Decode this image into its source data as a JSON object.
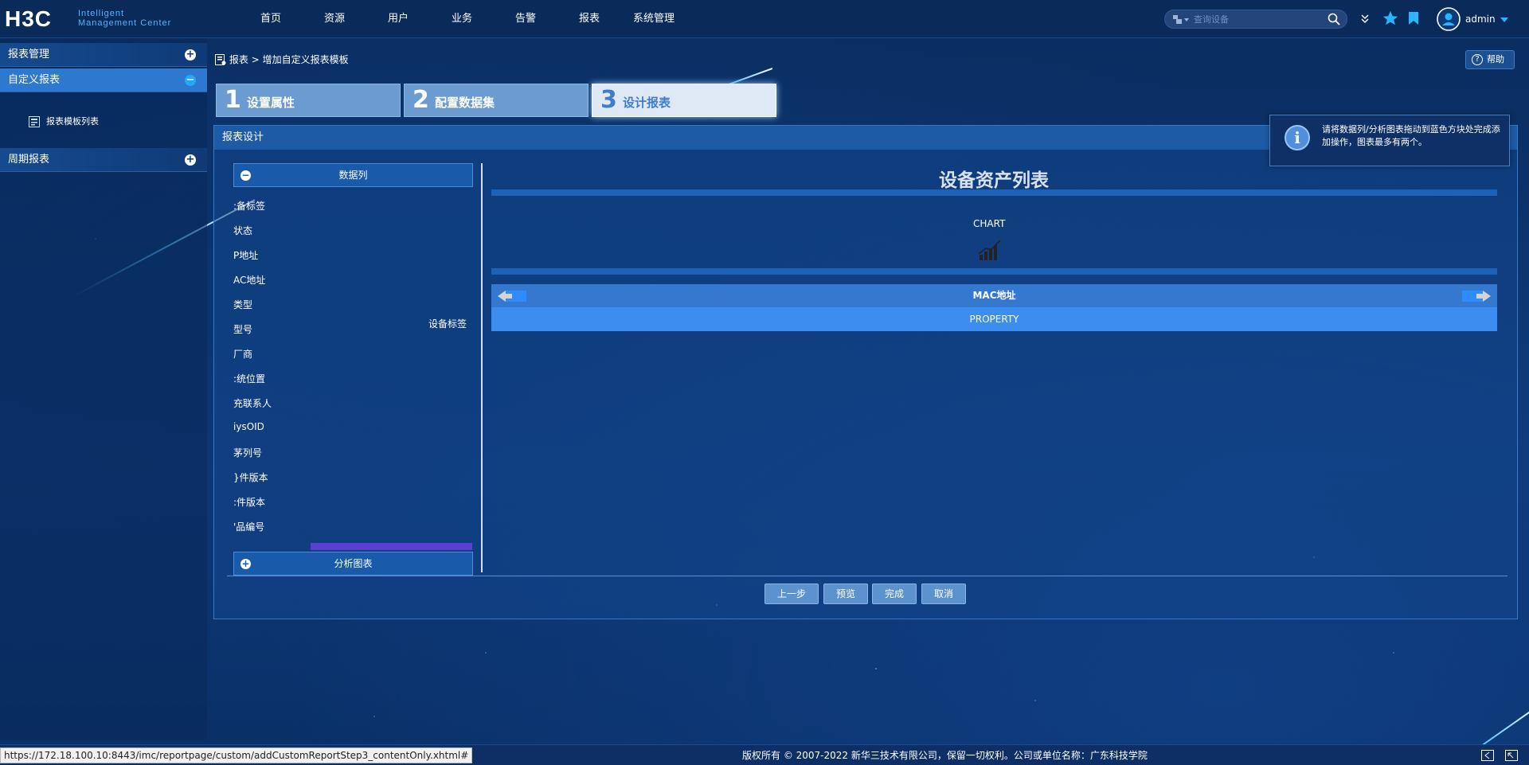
{
  "brand": {
    "logo": "H3C",
    "sub1": "Intelligent",
    "sub2": "Management Center"
  },
  "nav": [
    "首页",
    "资源",
    "用户",
    "业务",
    "告警",
    "报表",
    "系统管理"
  ],
  "search": {
    "placeholder": "查询设备"
  },
  "user": {
    "name": "admin"
  },
  "sidebar": {
    "group1": "报表管理",
    "active": "自定义报表",
    "sub_item": "报表模板列表",
    "group2": "周期报表"
  },
  "breadcrumb": {
    "root": "报表",
    "sep": ">",
    "current": "增加自定义报表模板"
  },
  "help": "帮助",
  "steps": [
    {
      "num": "1",
      "label": "设置属性"
    },
    {
      "num": "2",
      "label": "配置数据集"
    },
    {
      "num": "3",
      "label": "设计报表"
    }
  ],
  "panel": {
    "title": "报表设计"
  },
  "tooltip": "请将数据列/分析图表拖动到蓝色方块处完成添加操作，图表最多有两个。",
  "data_pane": {
    "header": "数据列",
    "fields": [
      ":备标签",
      "状态",
      "P地址",
      "AC地址",
      "类型",
      "型号",
      "厂商",
      ":统位置",
      "充联系人",
      "iysOID",
      "茅列号",
      "}件版本",
      ":件版本",
      "'品编号"
    ],
    "drag_preview": "设备标签",
    "charts_header": "分析图表"
  },
  "canvas": {
    "title": "设备资产列表",
    "chart_label": "CHART",
    "table_header": "MAC地址",
    "table_row": "PROPERTY"
  },
  "buttons": {
    "prev": "上一步",
    "preview": "预览",
    "finish": "完成",
    "cancel": "取消"
  },
  "statusbar": {
    "url": "https://172.18.100.10:8443/imc/reportpage/custom/addCustomReportStep3_contentOnly.xhtml#",
    "copyright": "版权所有 © 2007-2022 新华三技术有限公司，保留一切权利。公司或单位名称：广东科技学院"
  },
  "colors": {
    "accent": "#3b8df0",
    "header": "#1d5ba6",
    "background": "#0a2c5e"
  }
}
